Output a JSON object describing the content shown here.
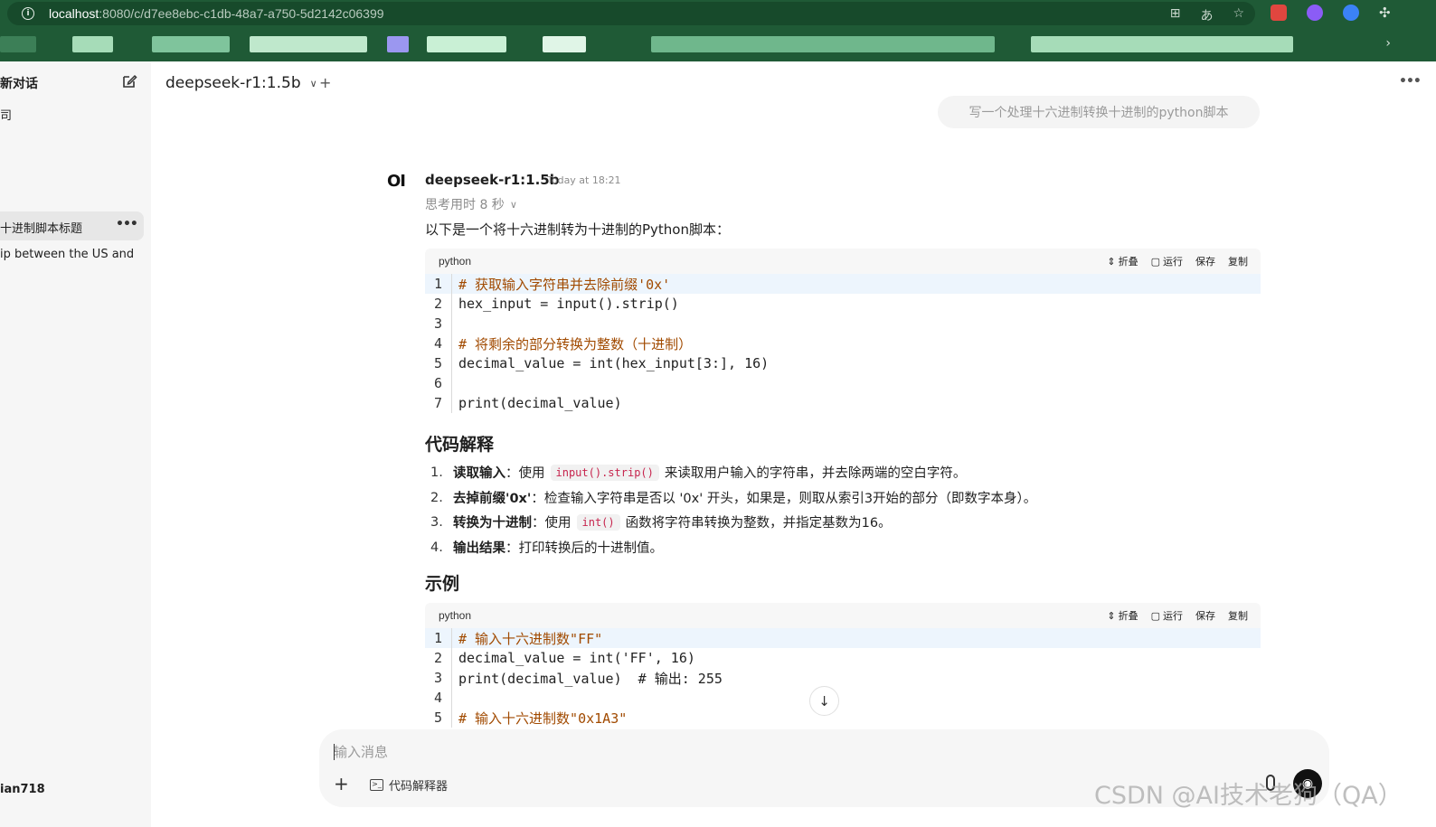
{
  "browser": {
    "url_host": "localhost",
    "url_path": ":8080/c/d7ee8ebc-c1db-48a7-a750-5d2142c06399"
  },
  "sidebar": {
    "new_chat_label": "新对话",
    "items": [
      {
        "label": "司"
      },
      {
        "label": "十进制脚本标题",
        "active": true
      },
      {
        "label": "ip between the US and"
      }
    ],
    "user_name": "ian718"
  },
  "header": {
    "model_name": "deepseek-r1:1.5b",
    "add_label": "+"
  },
  "user_message": "写一个处理十六进制转换十进制的python脚本",
  "assistant": {
    "avatar_text": "OI",
    "name": "deepseek-r1:1.5b",
    "time": "Today at 18:21",
    "thinking_label": "思考用时 8 秒",
    "intro": "以下是一个将十六进制转为十进制的Python脚本："
  },
  "code_actions": {
    "collapse": "折叠",
    "run": "运行",
    "save": "保存",
    "copy": "复制"
  },
  "code_blocks": [
    {
      "lang": "python",
      "lines": [
        {
          "num": "1",
          "text": "# 获取输入字符串并去除前缀'0x'"
        },
        {
          "num": "2",
          "text": "hex_input = input().strip()"
        },
        {
          "num": "3",
          "text": ""
        },
        {
          "num": "4",
          "text": "# 将剩余的部分转换为整数（十进制）"
        },
        {
          "num": "5",
          "text": "decimal_value = int(hex_input[3:], 16)"
        },
        {
          "num": "6",
          "text": ""
        },
        {
          "num": "7",
          "text": "print(decimal_value)"
        }
      ]
    },
    {
      "lang": "python",
      "lines": [
        {
          "num": "1",
          "text": "# 输入十六进制数\"FF\""
        },
        {
          "num": "2",
          "text": "decimal_value = int('FF', 16)"
        },
        {
          "num": "3",
          "text": "print(decimal_value)  # 输出: 255"
        },
        {
          "num": "4",
          "text": ""
        },
        {
          "num": "5",
          "text": "# 输入十六进制数\"0x1A3\""
        }
      ]
    }
  ],
  "explanation": {
    "heading": "代码解释",
    "items": [
      {
        "num": "1.",
        "bold": "读取输入",
        "pre": "：使用",
        "code": "input().strip()",
        "post": "来读取用户输入的字符串，并去除两端的空白字符。"
      },
      {
        "num": "2.",
        "bold": "去掉前缀'0x'",
        "pre": "：检查输入字符串是否以 '0x' 开头，如果是，则取从索引3开始的部分（即数字本身）。",
        "code": "",
        "post": ""
      },
      {
        "num": "3.",
        "bold": "转换为十进制",
        "pre": "：使用",
        "code": "int()",
        "post": "函数将字符串转换为整数，并指定基数为16。"
      },
      {
        "num": "4.",
        "bold": "输出结果",
        "pre": "：打印转换后的十进制值。",
        "code": "",
        "post": ""
      }
    ]
  },
  "example_heading": "示例",
  "input": {
    "placeholder": "输入消息",
    "code_interpreter_label": "代码解释器"
  },
  "watermark": "CSDN @AI技术老狗（QA）"
}
